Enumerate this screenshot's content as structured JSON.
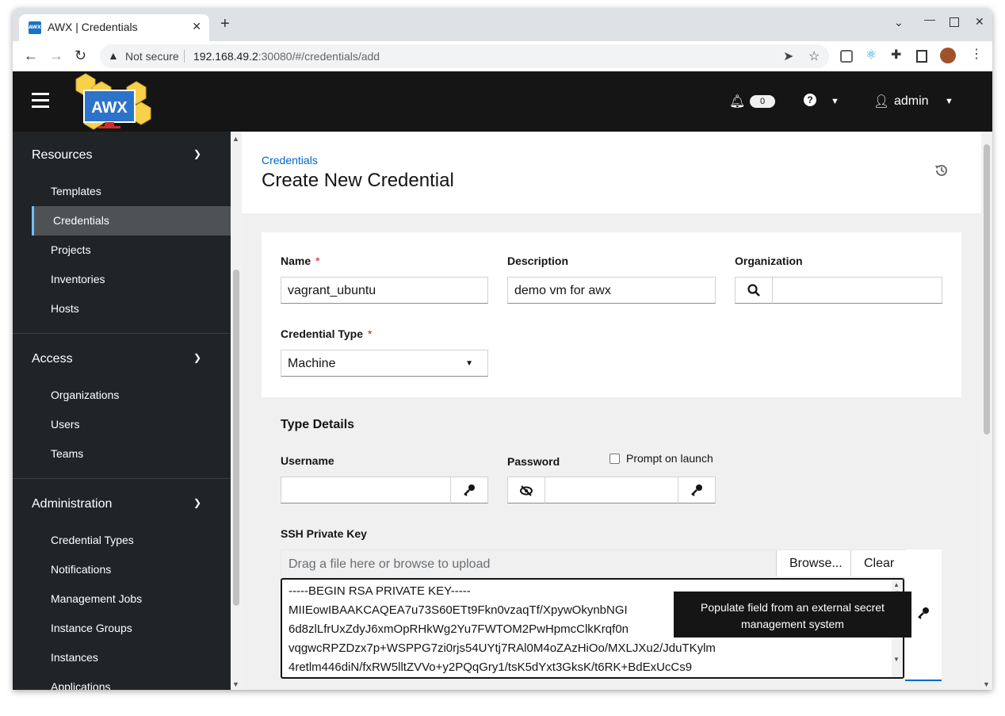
{
  "browser": {
    "tab_title": "AWX | Credentials",
    "favicon_text": "AWX",
    "not_secure": "Not secure",
    "url_host": "192.168.49.2",
    "url_path": ":30080/#/credentials/add"
  },
  "header": {
    "notification_count": "0",
    "user": "admin",
    "logo_text": "AWX"
  },
  "sidebar": {
    "sections": [
      {
        "title": "Resources",
        "items": [
          "Templates",
          "Credentials",
          "Projects",
          "Inventories",
          "Hosts"
        ]
      },
      {
        "title": "Access",
        "items": [
          "Organizations",
          "Users",
          "Teams"
        ]
      },
      {
        "title": "Administration",
        "items": [
          "Credential Types",
          "Notifications",
          "Management Jobs",
          "Instance Groups",
          "Instances",
          "Applications"
        ]
      }
    ],
    "active_item": "Credentials"
  },
  "page": {
    "breadcrumb": "Credentials",
    "title": "Create New Credential"
  },
  "form": {
    "name_label": "Name",
    "name_value": "vagrant_ubuntu",
    "description_label": "Description",
    "description_value": "demo vm for awx",
    "organization_label": "Organization",
    "credential_type_label": "Credential Type",
    "credential_type_value": "Machine",
    "required_mark": "*",
    "type_details_title": "Type Details",
    "username_label": "Username",
    "password_label": "Password",
    "prompt_on_launch": "Prompt on launch",
    "ssh_key_label": "SSH Private Key",
    "upload_placeholder": "Drag a file here or browse to upload",
    "browse_label": "Browse...",
    "clear_label": "Clear",
    "ssh_key_lines": [
      "-----BEGIN RSA PRIVATE KEY-----",
      "MIIEowIBAAKCAQEA7u73S60ETt9Fkn0vzaqTf/XpywOkynbNGI",
      "6d8zlLfrUxZdyJ6xmOpRHkWg2Yu7FWTOM2PwHpmcClkKrqf0n",
      "vqgwcRPZDzx7p+WSPPG7zi0rjs54UYtj7RAl0M4oZAzHiOo/MXLJXu2/JduTKylm",
      "4retlm446diN/fxRW5lltZVVo+y2PQqGry1/tsK5dYxt3GksK/t6RK+BdExUcCs9"
    ],
    "tooltip": "Populate field from an external secret management system"
  }
}
